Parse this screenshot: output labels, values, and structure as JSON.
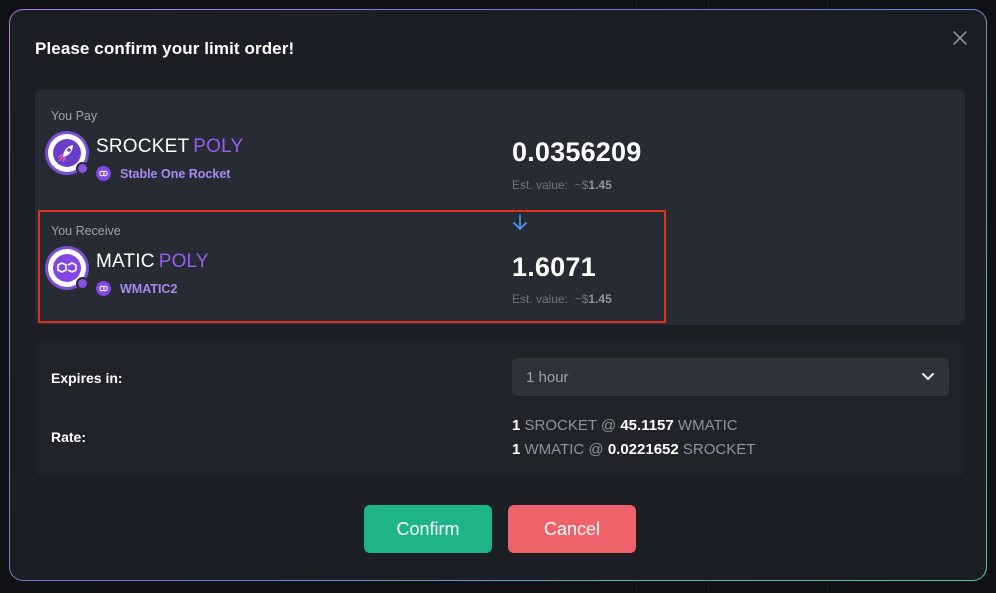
{
  "modal": {
    "title": "Please confirm your limit order!",
    "close_icon": "close-icon"
  },
  "pay": {
    "section_label": "You Pay",
    "token_symbol": "SROCKET",
    "chain": "POLY",
    "token_full_name": "Stable One Rocket",
    "amount": "0.0356209",
    "est_prefix": "Est. value:",
    "est_tilde": "~$",
    "est_value": "1.45",
    "icon": "rocket-token-icon"
  },
  "receive": {
    "section_label": "You Receive",
    "token_symbol": "MATIC",
    "chain": "POLY",
    "token_full_name": "WMATIC2",
    "amount": "1.6071",
    "est_prefix": "Est. value:",
    "est_tilde": "~$",
    "est_value": "1.45",
    "icon": "polygon-token-icon"
  },
  "details": {
    "expires_label": "Expires in:",
    "expires_value": "1 hour",
    "expires_options_visible": [
      "1 hour"
    ],
    "rate_label": "Rate:",
    "rate_lines": [
      {
        "qty": "1",
        "base": "SROCKET",
        "at": "@",
        "price": "45.1157",
        "quote": "WMATIC"
      },
      {
        "qty": "1",
        "base": "WMATIC",
        "at": "@",
        "price": "0.0221652",
        "quote": "SROCKET"
      }
    ]
  },
  "actions": {
    "confirm_label": "Confirm",
    "cancel_label": "Cancel"
  },
  "colors": {
    "accent_purple": "#9a5cf0",
    "confirm_green": "#1db488",
    "cancel_red": "#f0626a",
    "highlight_red": "#e0301e",
    "arrow_blue": "#4a9ff5"
  }
}
